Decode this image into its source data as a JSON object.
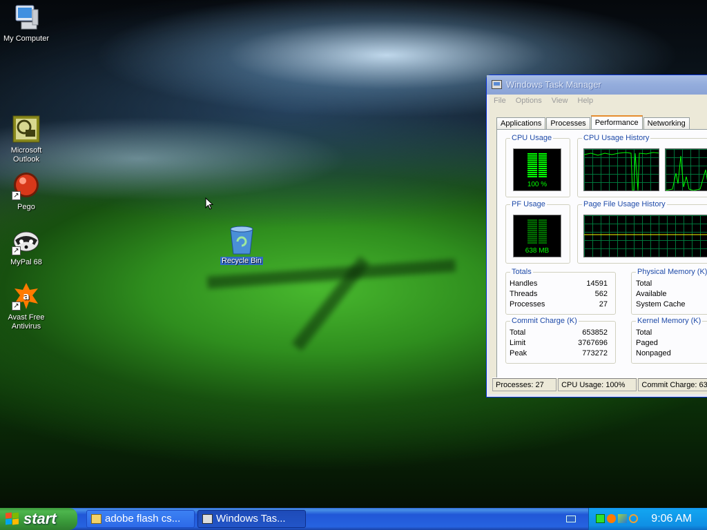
{
  "desktop": {
    "icons": [
      {
        "label": "My Computer",
        "icon": "computer-icon"
      },
      {
        "label": "Microsoft Outlook",
        "icon": "outlook-icon",
        "shortcut": true
      },
      {
        "label": "Pego",
        "icon": "pego-icon",
        "shortcut": true
      },
      {
        "label": "MyPal 68",
        "icon": "mypal-icon",
        "shortcut": true
      },
      {
        "label": "Avast Free Antivirus",
        "icon": "avast-icon",
        "shortcut": true
      },
      {
        "label": "Recycle Bin",
        "icon": "recycle-bin-icon",
        "selected": true
      }
    ]
  },
  "task_manager": {
    "title": "Windows Task Manager",
    "menu": [
      "File",
      "Options",
      "View",
      "Help"
    ],
    "tabs": [
      "Applications",
      "Processes",
      "Performance",
      "Networking"
    ],
    "active_tab": "Performance",
    "cpu_usage": {
      "label": "CPU Usage",
      "value": "100 %",
      "level": 1.0
    },
    "cpu_history": {
      "label": "CPU Usage History"
    },
    "pf_usage": {
      "label": "PF Usage",
      "value": "638 MB"
    },
    "pf_history": {
      "label": "Page File Usage History"
    },
    "totals": {
      "label": "Totals",
      "handles": {
        "k": "Handles",
        "v": "14591"
      },
      "threads": {
        "k": "Threads",
        "v": "562"
      },
      "processes": {
        "k": "Processes",
        "v": "27"
      }
    },
    "physical_memory": {
      "label": "Physical Memory (K)",
      "rows": [
        "Total",
        "Available",
        "System Cache"
      ]
    },
    "commit_charge": {
      "label": "Commit Charge (K)",
      "total": {
        "k": "Total",
        "v": "653852"
      },
      "limit": {
        "k": "Limit",
        "v": "3767696"
      },
      "peak": {
        "k": "Peak",
        "v": "773272"
      }
    },
    "kernel_memory": {
      "label": "Kernel Memory (K)",
      "rows": [
        "Total",
        "Paged",
        "Nonpaged"
      ]
    },
    "status": {
      "processes": "Processes: 27",
      "cpu": "CPU Usage: 100%",
      "commit": "Commit Charge: 63"
    }
  },
  "taskbar": {
    "start_label": "start",
    "buttons": [
      {
        "label": "adobe flash cs...",
        "icon": "folder-icon",
        "active": false
      },
      {
        "label": "Windows Tas...",
        "icon": "task-manager-icon",
        "active": true
      }
    ],
    "clock": "9:06 AM"
  },
  "colors": {
    "graph_green": "#00ff00",
    "xp_blue": "#245edb",
    "start_green": "#3a9a3a"
  }
}
